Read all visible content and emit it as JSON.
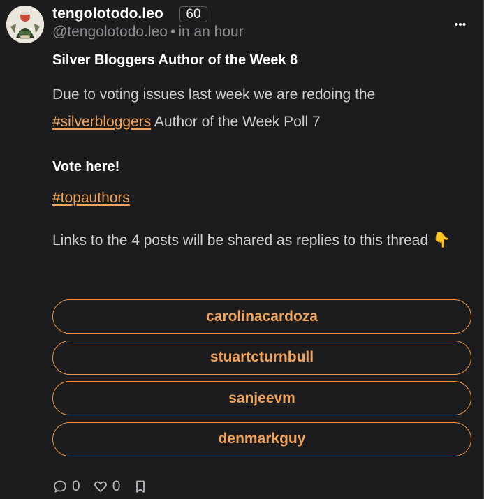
{
  "author": {
    "display_name": "tengolotodo.leo",
    "reputation": "60",
    "handle": "@tengolotodo.leo",
    "separator": "•",
    "timestamp": "in an hour"
  },
  "post": {
    "title": "Silver Bloggers Author of the Week 8",
    "para1_before": "Due to voting issues last week we are redoing the",
    "para1_tag": "#silverbloggers",
    "para1_after": " Author of the Week Poll 7",
    "vote_text": "Vote here!",
    "tag2": "#topauthors",
    "para2": "Links to the 4 posts will be shared as replies to this thread 👇"
  },
  "poll": {
    "options": [
      "carolinacardoza",
      "stuartcturnbull",
      "sanjeevm",
      "denmarkguy"
    ]
  },
  "footer": {
    "reply_count": "0",
    "like_count": "0"
  },
  "icons": {
    "menu": "more-horizontal-icon",
    "reply": "comment-icon",
    "like": "heart-icon",
    "bookmark": "bookmark-icon"
  },
  "colors": {
    "background": "#1c1b1d",
    "accent": "#f0a35e",
    "muted": "#8e8d91"
  }
}
